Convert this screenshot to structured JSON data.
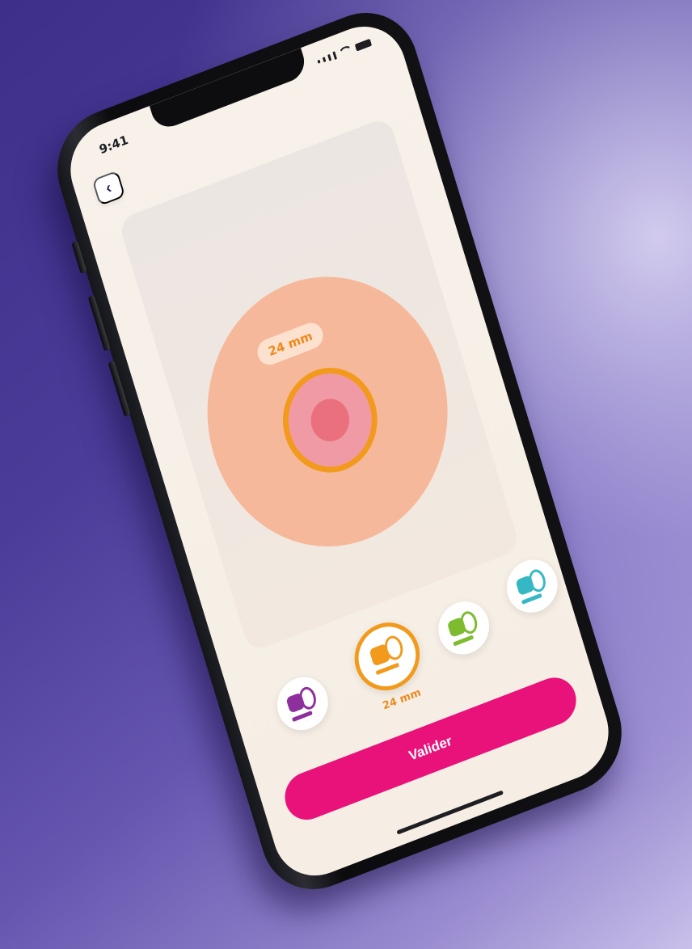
{
  "status_bar": {
    "time": "9:41"
  },
  "header": {
    "back_icon": "chevron-left-icon",
    "back_glyph": "‹"
  },
  "preview": {
    "size_label": "24 mm"
  },
  "picker": {
    "options": [
      {
        "color": "#8e2f9e"
      },
      {
        "color": "#f29a1c",
        "label": "24 mm"
      },
      {
        "color": "#7dbb2f"
      },
      {
        "color": "#36b8c4"
      }
    ]
  },
  "actions": {
    "validate_label": "Valider"
  },
  "colors": {
    "accent": "#e8127a",
    "ring": "#f29a1c",
    "skin": "#f6b89a",
    "stoma": "#ef9aa4"
  }
}
